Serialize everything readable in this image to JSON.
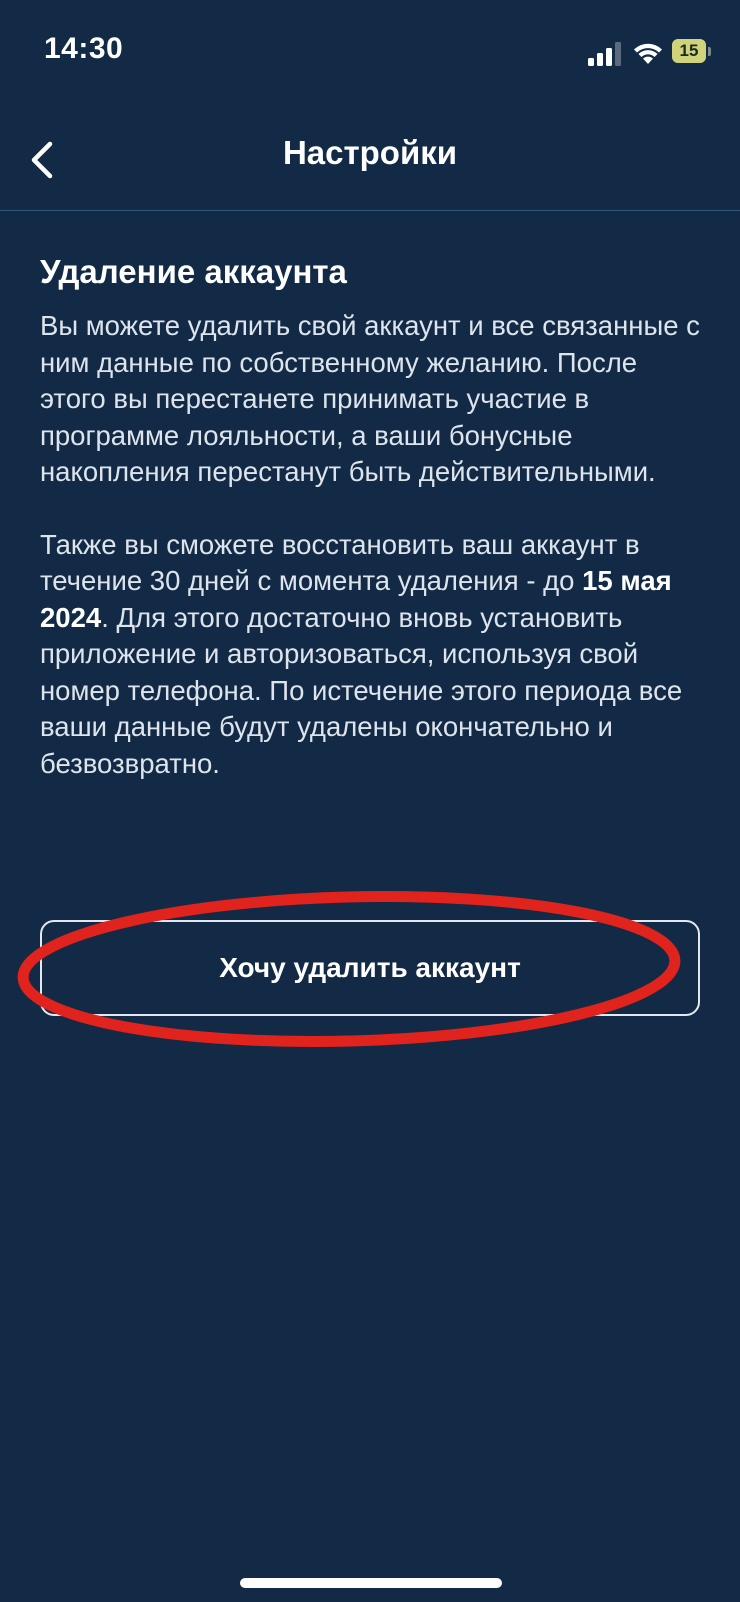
{
  "status_bar": {
    "time": "14:30",
    "battery_level": "15",
    "signal_icon": "cellular-signal-icon",
    "wifi_icon": "wifi-icon"
  },
  "nav": {
    "back_icon": "chevron-left-icon",
    "title": "Настройки"
  },
  "section": {
    "heading": "Удаление аккаунта",
    "paragraph1": "Вы можете удалить свой аккаунт и все связанные с ним данные по собственному желанию. После этого вы перестанете принимать участие в программе лояльности, а ваши бонусные накопления перестанут быть действительными.",
    "paragraph2_before": "Также вы сможете восстановить ваш аккаунт в течение 30 дней с момента удаления - до ",
    "paragraph2_date": "15 мая 2024",
    "paragraph2_after": ". Для этого достаточно вновь установить приложение и авторизоваться, используя свой номер телефона. По истечение этого периода все ваши данные будут удалены окончательно и безвозвратно."
  },
  "actions": {
    "delete_label": "Хочу удалить аккаунт"
  },
  "colors": {
    "background": "#132a46",
    "highlight": "#e0231c",
    "text": "#ffffff"
  }
}
